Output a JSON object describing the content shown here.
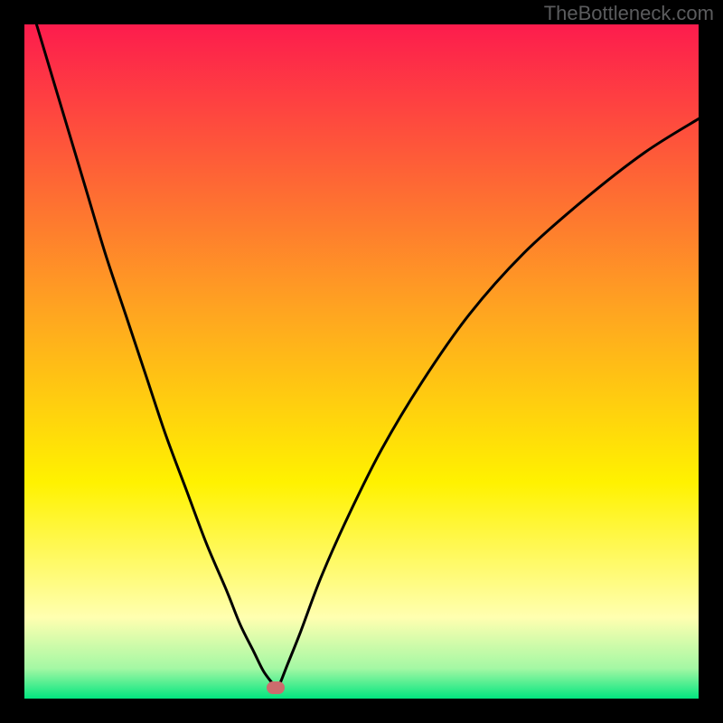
{
  "watermark": "TheBottleneck.com",
  "marker": {
    "x_pct": 37.3,
    "y_pct": 98.4
  },
  "colors": {
    "top": "#fd1c4d",
    "midUpper": "#ffa321",
    "mid": "#fff200",
    "paleYellow": "#ffffb0",
    "nearBottom": "#a4f8a4",
    "bottom": "#02e57f",
    "curve": "#000000",
    "marker": "#cc6c6d",
    "watermark": "#5b5c5e"
  },
  "chart_data": {
    "type": "line",
    "title": "",
    "xlabel": "",
    "ylabel": "",
    "xlim_pct": [
      0,
      100
    ],
    "ylim_pct": [
      0,
      100
    ],
    "series": [
      {
        "name": "bottleneck-curve",
        "x_pct": [
          0,
          3,
          6,
          9,
          12,
          15,
          18,
          21,
          24,
          27,
          30,
          32,
          34,
          35.5,
          37,
          37.3,
          37.8,
          39,
          41,
          44,
          48,
          53,
          59,
          66,
          74,
          83,
          92,
          100
        ],
        "y_pct": [
          -6,
          4,
          14,
          24,
          34,
          43,
          52,
          61,
          69,
          77,
          84,
          89,
          93,
          96,
          98,
          98.5,
          98,
          95,
          90,
          82,
          73,
          63,
          53,
          43,
          34,
          26,
          19,
          14
        ]
      }
    ],
    "gradient_stops": [
      {
        "offset": 0.0,
        "color": "#fd1c4d"
      },
      {
        "offset": 0.42,
        "color": "#ffa321"
      },
      {
        "offset": 0.68,
        "color": "#fff200"
      },
      {
        "offset": 0.88,
        "color": "#ffffb0"
      },
      {
        "offset": 0.955,
        "color": "#a4f8a4"
      },
      {
        "offset": 1.0,
        "color": "#02e57f"
      }
    ],
    "note": "x_pct / y_pct are percentages of the inner plot area from left and top respectively; curve estimated from pixels."
  }
}
